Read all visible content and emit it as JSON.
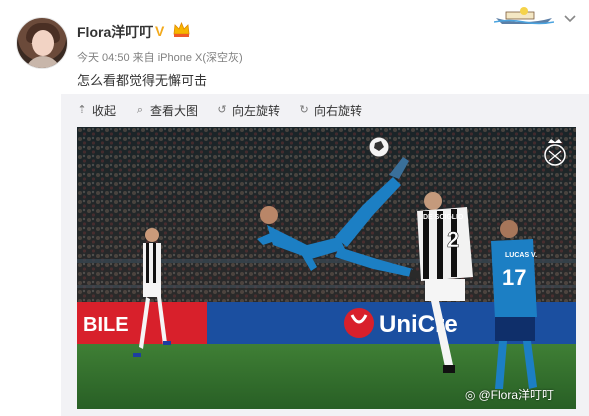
{
  "user": {
    "name": "Flora洋叮叮",
    "verified_mark": "V"
  },
  "post": {
    "meta": "今天 04:50 来自 iPhone X(深空灰)",
    "text": "怎么看都觉得无懈可击"
  },
  "toolbar": {
    "collapse_label": "收起",
    "view_large_label": "查看大图",
    "rotate_left_label": "向左旋转",
    "rotate_right_label": "向右旋转"
  },
  "photo": {
    "watermark": "@Flora洋叮叮",
    "jersey_2_name": "DE SCIGLIO",
    "jersey_2_number": "2",
    "jersey_17_name": "LUCAS V.",
    "jersey_17_number": "17",
    "board_left_text": "BILE",
    "board_right_text": "UniCre"
  },
  "colors": {
    "accent_verified": "#f2a91c",
    "panel_bg": "#f2f2f5",
    "pitch_green": "#2f6d2c",
    "real_kit": "#1c7fc4",
    "board_red": "#d8202b",
    "board_blue": "#1b4fa0"
  },
  "icons": [
    "crown-badge-icon",
    "boat-decoration-icon",
    "chevron-down-icon",
    "collapse-icon",
    "zoom-icon",
    "rotate-left-icon",
    "rotate-right-icon",
    "weibo-logo-icon"
  ]
}
